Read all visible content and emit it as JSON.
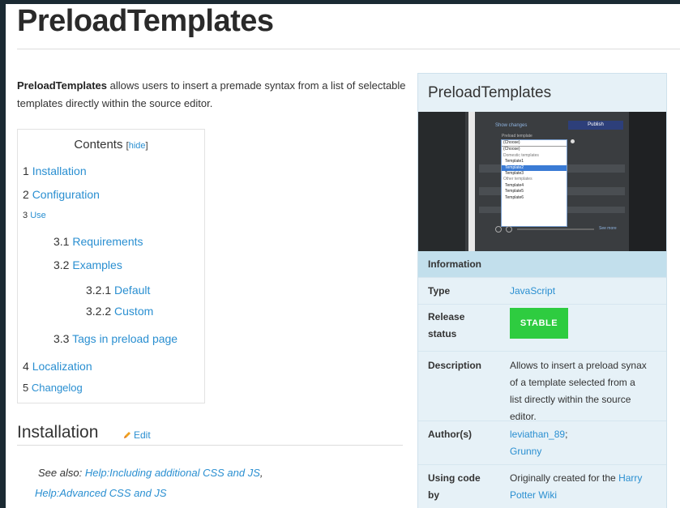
{
  "page": {
    "title": "PreloadTemplates",
    "intro_bold": "PreloadTemplates",
    "intro_rest": " allows users to insert a premade syntax from a list of selectable templates directly within the source editor."
  },
  "toc": {
    "heading": "Contents",
    "hide_open": "[",
    "hide_link": "hide",
    "hide_close": "]",
    "items": [
      {
        "num": "1",
        "label": "Installation"
      },
      {
        "num": "2",
        "label": "Configuration"
      },
      {
        "num": "3",
        "label": "Use"
      },
      {
        "num": "3.1",
        "label": "Requirements"
      },
      {
        "num": "3.2",
        "label": "Examples"
      },
      {
        "num": "3.2.1",
        "label": "Default"
      },
      {
        "num": "3.2.2",
        "label": "Custom"
      },
      {
        "num": "3.3",
        "label": "Tags in preload page"
      },
      {
        "num": "4",
        "label": "Localization"
      },
      {
        "num": "5",
        "label": "Changelog"
      }
    ]
  },
  "installation": {
    "heading": "Installation",
    "edit_label": "Edit",
    "see_also_prefix": "See also: ",
    "link1": "Help:Including additional CSS and JS",
    "link1_suffix": ",",
    "link2": "Help:Advanced CSS and JS"
  },
  "infobox": {
    "title": "PreloadTemplates",
    "section": "Information",
    "screenshot": {
      "show_changes": "Show changes",
      "publish": "Publish",
      "dropdown_label": "Preload template",
      "selected": "(Choose)",
      "options": [
        "(Choose)",
        "Domestic templates",
        "Template1",
        "Template2",
        "Template3",
        "Other templates",
        "Template4",
        "Template5",
        "Template6"
      ],
      "footer_link": "See more"
    },
    "type_label": "Type",
    "type_value": "JavaScript",
    "release_label": "Release status",
    "release_value": "STABLE",
    "description_label": "Description",
    "description_value": "Allows to insert a preload synax of a template selected from a list directly within the source editor.",
    "authors_label": "Author(s)",
    "author1": "leviathan_89",
    "author1_suffix": ";",
    "author2": "Grunny",
    "using_code_label": "Using code by",
    "using_code_prefix": "Originally created for the ",
    "using_code_link": "Harry Potter Wiki",
    "colors": {
      "badge": "#2ecc40",
      "link": "#2a8fd1",
      "infobox_bg": "#e6f1f7",
      "infobox_section": "#c2dfec"
    }
  }
}
